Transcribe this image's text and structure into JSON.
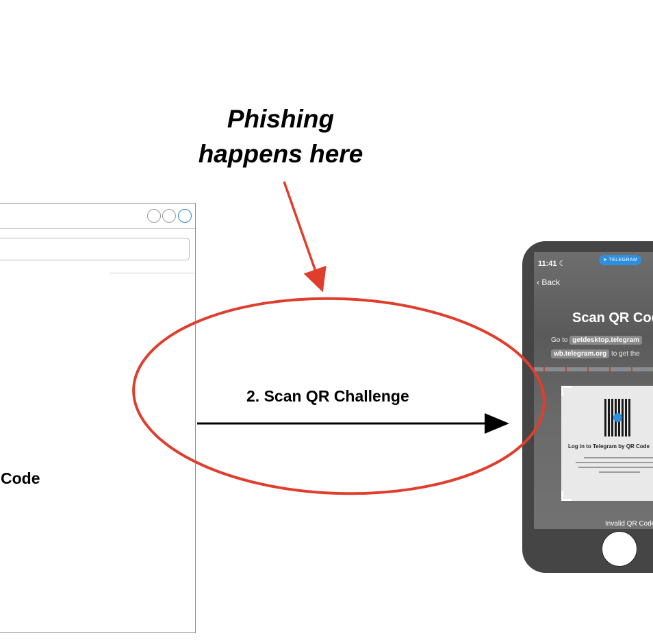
{
  "annotation": {
    "line1": "Phishing",
    "line2": "happens here",
    "color": "#000000"
  },
  "browser": {
    "partial_text": "Code"
  },
  "arrow": {
    "label": "2. Scan QR Challenge",
    "highlight_color": "#e03e2d"
  },
  "phone": {
    "status_time": "11:41",
    "app_pill": "TELEGRAM",
    "back_label": "Back",
    "title": "Scan QR Cod",
    "instruction_prefix": "Go to",
    "instruction_link1": "getdesktop.telegram",
    "instruction_link2": "b.telegram.org",
    "instruction_prefix2": "w",
    "instruction_suffix": "to get the",
    "qr_card_title": "Log in to Telegram by QR Code",
    "status_message": "Invalid QR Code",
    "accent_color": "#2d8fe0"
  }
}
